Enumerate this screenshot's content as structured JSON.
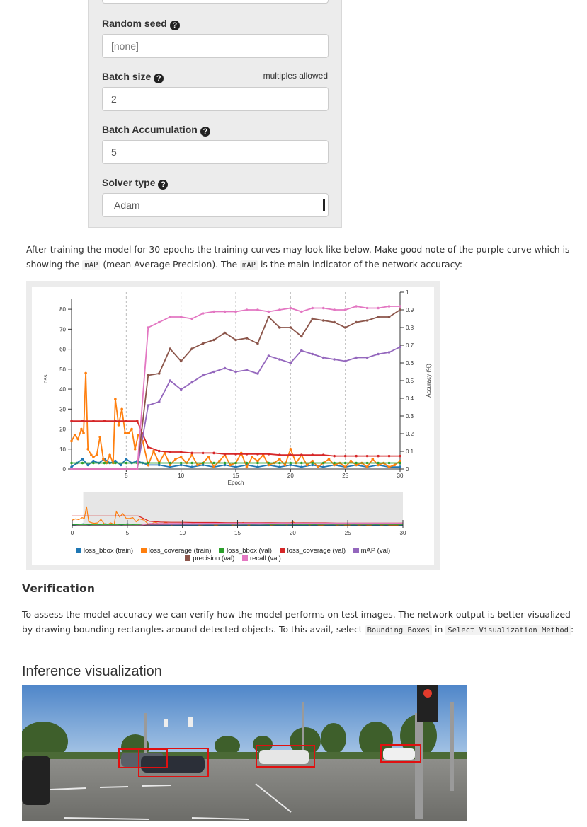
{
  "form": {
    "random_seed": {
      "label": "Random seed",
      "placeholder": "[none]"
    },
    "batch_size": {
      "label": "Batch size",
      "hint": "multiples allowed",
      "value": "2"
    },
    "batch_accumulation": {
      "label": "Batch Accumulation",
      "value": "5"
    },
    "solver_type": {
      "label": "Solver type",
      "value": "Adam"
    },
    "help_glyph": "?"
  },
  "intro": {
    "part1": "After training the model for 30 epochs the training curves may look like below. Make good note of the purple curve which is showing the ",
    "code1": "mAP",
    "part2": " (mean Average Precision). The ",
    "code2": "mAP",
    "part3": " is the main indicator of the network accuracy:"
  },
  "verification": {
    "heading": "Verification",
    "part1": "To assess the model accuracy we can verify how the model performs on test images. The network output is better visualized by drawing bounding rectangles around detected objects. To this avail, select ",
    "code1": "Bounding Boxes",
    "part2": " in ",
    "code2": "Select Visualization Method",
    "part3": ":"
  },
  "inference": {
    "heading": "Inference visualization"
  },
  "chart_data": {
    "type": "line",
    "xlabel": "Epoch",
    "ylabel": "Loss",
    "y2label": "Accuracy (%)",
    "xlim": [
      0,
      30
    ],
    "ylim": [
      0,
      85
    ],
    "y2lim": [
      0,
      1
    ],
    "xticks": [
      5,
      10,
      15,
      20,
      25,
      30
    ],
    "yticks": [
      0,
      10,
      20,
      30,
      40,
      50,
      60,
      70,
      80
    ],
    "y2ticks": [
      0,
      0.1,
      0.2,
      0.3,
      0.4,
      0.5,
      0.6,
      0.7,
      0.8,
      0.9,
      1
    ],
    "grid": "vertical dashed",
    "legend_position": "bottom",
    "series": [
      {
        "name": "loss_bbox (train)",
        "axis": "left",
        "color": "#1f77b4",
        "x": [
          0,
          0.5,
          1,
          1.5,
          2,
          2.5,
          3,
          3.5,
          4,
          4.5,
          5,
          5.5,
          6,
          6.5,
          7,
          8,
          9,
          10,
          11,
          12,
          13,
          14,
          15,
          16,
          17,
          18,
          19,
          20,
          21,
          22,
          23,
          24,
          25,
          26,
          27,
          28,
          29,
          30
        ],
        "y": [
          1,
          3,
          5,
          2,
          4,
          3,
          5,
          3,
          4,
          2,
          5,
          3,
          4,
          3,
          2,
          2,
          1,
          2,
          1,
          2,
          1,
          2,
          1,
          2,
          1,
          2,
          1,
          2,
          1,
          2,
          1,
          2,
          1,
          2,
          1,
          2,
          1,
          1
        ]
      },
      {
        "name": "loss_coverage (train)",
        "axis": "left",
        "color": "#ff7f0e",
        "x": [
          0,
          0.3,
          0.6,
          0.9,
          1.1,
          1.3,
          1.5,
          1.8,
          2,
          2.3,
          2.6,
          2.9,
          3.2,
          3.5,
          3.8,
          4,
          4.3,
          4.6,
          4.9,
          5.2,
          5.5,
          5.8,
          6.1,
          6.5,
          7,
          7.5,
          8,
          8.5,
          9,
          9.5,
          10,
          10.5,
          11,
          11.5,
          12,
          12.5,
          13,
          13.5,
          14,
          14.5,
          15,
          15.5,
          16,
          16.5,
          17,
          17.5,
          18,
          18.5,
          19,
          19.5,
          20,
          20.5,
          21,
          21.5,
          22,
          22.5,
          23,
          23.5,
          24,
          24.5,
          25,
          25.5,
          26,
          26.5,
          27,
          27.5,
          28,
          28.5,
          29,
          29.5,
          30
        ],
        "y": [
          14,
          17,
          15,
          20,
          18,
          48,
          10,
          7,
          6,
          7,
          16,
          5,
          3,
          7,
          3,
          35,
          22,
          30,
          18,
          18,
          20,
          10,
          17,
          14,
          2,
          9,
          3,
          8,
          2,
          5,
          6,
          3,
          7,
          2,
          3,
          6,
          1,
          4,
          7,
          2,
          3,
          8,
          1,
          6,
          4,
          7,
          2,
          3,
          5,
          2,
          10,
          3,
          7,
          2,
          4,
          1,
          3,
          5,
          2,
          3,
          1,
          4,
          2,
          3,
          1,
          5,
          2,
          3,
          1,
          2,
          4
        ]
      },
      {
        "name": "loss_bbox (val)",
        "axis": "left",
        "color": "#2ca02c",
        "x": [
          0,
          1,
          2,
          3,
          4,
          5,
          6,
          7,
          8,
          9,
          10,
          11,
          12,
          13,
          14,
          15,
          16,
          17,
          18,
          19,
          20,
          21,
          22,
          23,
          24,
          25,
          26,
          27,
          28,
          29,
          30
        ],
        "y": [
          3,
          3,
          3,
          3,
          3,
          3,
          3,
          3,
          3,
          3,
          3,
          3,
          3,
          3,
          3,
          3,
          3,
          3,
          3,
          3,
          3,
          3,
          3,
          3,
          3,
          3,
          3,
          3,
          3,
          3,
          3
        ]
      },
      {
        "name": "loss_coverage (val)",
        "axis": "left",
        "color": "#d62728",
        "x": [
          0,
          1,
          2,
          3,
          4,
          5,
          6,
          7,
          8,
          9,
          10,
          11,
          12,
          13,
          14,
          15,
          16,
          17,
          18,
          19,
          20,
          21,
          22,
          23,
          24,
          25,
          26,
          27,
          28,
          29,
          30
        ],
        "y": [
          24,
          24,
          24,
          24,
          24,
          24,
          24,
          11,
          9,
          8.5,
          8.5,
          8,
          8,
          8,
          7.5,
          7.5,
          7.5,
          7.5,
          7.5,
          7,
          7,
          7,
          7,
          7,
          6.5,
          6.5,
          6.5,
          6.5,
          6.5,
          6.5,
          6.5
        ]
      },
      {
        "name": "mAP (val)",
        "axis": "right",
        "color": "#9467bd",
        "x": [
          0,
          6,
          7,
          8,
          9,
          10,
          11,
          12,
          13,
          14,
          15,
          16,
          17,
          18,
          19,
          20,
          21,
          22,
          23,
          24,
          25,
          26,
          27,
          28,
          29,
          30
        ],
        "y": [
          0,
          0,
          0.36,
          0.38,
          0.5,
          0.45,
          0.49,
          0.53,
          0.55,
          0.57,
          0.55,
          0.56,
          0.54,
          0.64,
          0.62,
          0.6,
          0.67,
          0.65,
          0.63,
          0.62,
          0.61,
          0.63,
          0.63,
          0.65,
          0.66,
          0.69
        ]
      },
      {
        "name": "precision (val)",
        "axis": "right",
        "color": "#8c564b",
        "x": [
          0,
          6,
          7,
          8,
          9,
          10,
          11,
          12,
          13,
          14,
          15,
          16,
          17,
          18,
          19,
          20,
          21,
          22,
          23,
          24,
          25,
          26,
          27,
          28,
          29,
          30
        ],
        "y": [
          0,
          0,
          0.53,
          0.54,
          0.68,
          0.61,
          0.68,
          0.71,
          0.73,
          0.77,
          0.73,
          0.74,
          0.71,
          0.86,
          0.8,
          0.8,
          0.75,
          0.85,
          0.84,
          0.83,
          0.8,
          0.83,
          0.84,
          0.86,
          0.86,
          0.9
        ]
      },
      {
        "name": "recall (val)",
        "axis": "right",
        "color": "#e377c2",
        "x": [
          0,
          6,
          7,
          8,
          9,
          10,
          11,
          12,
          13,
          14,
          15,
          16,
          17,
          18,
          19,
          20,
          21,
          22,
          23,
          24,
          25,
          26,
          27,
          28,
          29,
          30
        ],
        "y": [
          0,
          0,
          0.8,
          0.83,
          0.86,
          0.86,
          0.85,
          0.88,
          0.89,
          0.89,
          0.89,
          0.9,
          0.9,
          0.89,
          0.9,
          0.91,
          0.89,
          0.91,
          0.91,
          0.9,
          0.9,
          0.92,
          0.91,
          0.91,
          0.92,
          0.92
        ]
      }
    ]
  }
}
